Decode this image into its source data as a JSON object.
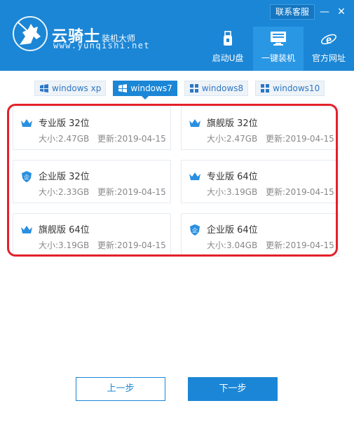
{
  "header": {
    "brand": "云骑士",
    "brand_sub": "装机大师",
    "url": "www.yunqishi.net",
    "contact": "联系客服",
    "minimize": "—",
    "close": "✕",
    "nav": [
      {
        "label": "启动U盘",
        "icon": "usb-icon"
      },
      {
        "label": "一键装机",
        "icon": "computer-icon"
      },
      {
        "label": "官方网址",
        "icon": "ie-icon"
      }
    ]
  },
  "tabs": [
    {
      "label": "windows xp"
    },
    {
      "label": "windows7"
    },
    {
      "label": "windows8"
    },
    {
      "label": "windows10"
    }
  ],
  "systems": [
    {
      "name": "专业版 32位",
      "size": "大小:2.47GB",
      "date": "更新:2019-04-15",
      "icon": "crown-icon"
    },
    {
      "name": "旗舰版 32位",
      "size": "大小:2.47GB",
      "date": "更新:2019-04-15",
      "icon": "crown-icon"
    },
    {
      "name": "企业版 32位",
      "size": "大小:2.33GB",
      "date": "更新:2019-04-15",
      "icon": "enterprise-shield-icon"
    },
    {
      "name": "专业版 64位",
      "size": "大小:3.19GB",
      "date": "更新:2019-04-15",
      "icon": "crown-icon"
    },
    {
      "name": "旗舰版 64位",
      "size": "大小:3.19GB",
      "date": "更新:2019-04-15",
      "icon": "crown-icon"
    },
    {
      "name": "企业版 64位",
      "size": "大小:3.04GB",
      "date": "更新:2019-04-15",
      "icon": "enterprise-shield-icon"
    }
  ],
  "buttons": {
    "prev": "上一步",
    "next": "下一步"
  },
  "colors": {
    "primary": "#1b86d6",
    "highlight": "#e3202a"
  }
}
